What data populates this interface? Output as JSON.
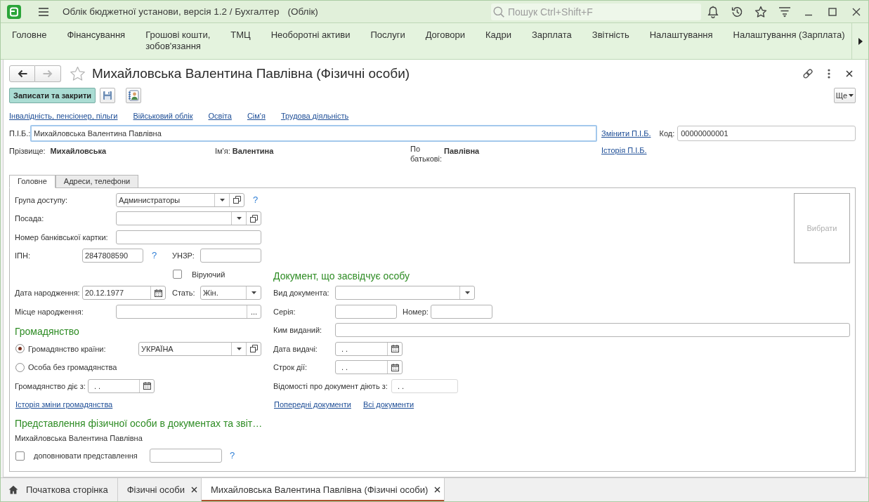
{
  "title_bar": {
    "title": "Облік бюджетної установи, версія 1.2 / Бухгалтер",
    "mode": "(Облік)",
    "search": {
      "placeholder": "Пошук Ctrl+Shift+F"
    }
  },
  "sections": [
    "Головне",
    "Фінансування",
    "Грошові кошти,\nзобов'язання",
    "ТМЦ",
    "Необоротні активи",
    "Послуги",
    "Договори",
    "Кадри",
    "Зарплата",
    "Звітність",
    "Налаштування",
    "Налаштування (Зарплата)"
  ],
  "form": {
    "navigation": [
      {
        "kind": "back",
        "disabled": false
      },
      {
        "kind": "forward",
        "disabled": true
      }
    ],
    "favorite": false,
    "title": "Михайловська Валентина Павлівна (Фізичні особи)",
    "save_close_button": "Записати та закрити",
    "more_button": "Ще",
    "links": [
      "Інвалідність, пенсіонер, пільги",
      "Військовий облік",
      "Освіта",
      "Сім'я",
      "Трудова діяльність"
    ],
    "full_name": {
      "label": "П.І.Б.:",
      "value": "Михайловська Валентина Павлівна",
      "focused": true
    },
    "change_name_link": "Змінити П.І.Б.",
    "code": {
      "label": "Код:",
      "value": "00000000001"
    },
    "name_parts": [
      {
        "label": "Прізвище:",
        "value": "Михайловська"
      },
      {
        "label": "Ім'я:",
        "value": "Валентина"
      },
      {
        "label": "По батькові:",
        "value": "Павлівна"
      }
    ],
    "name_history_link": "Історія П.І.Б.",
    "tabs": [
      {
        "label": "Головне",
        "selected": true
      },
      {
        "label": "Адреси, телефони",
        "selected": false
      }
    ],
    "main": {
      "access_group": {
        "label": "Група доступу:",
        "value": "Администраторы",
        "help": "?"
      },
      "position": {
        "label": "Посада:"
      },
      "bank_card": {
        "label": "Номер банківської картки:"
      },
      "tax_id": {
        "label": "ІПН:",
        "value": "2847808590",
        "help": "?"
      },
      "unzr": {
        "label": "УНЗР:"
      },
      "religious": {
        "label": "Віруючий",
        "checked": false
      },
      "birth_date": {
        "label": "Дата народження:",
        "value": "20.12.1977"
      },
      "sex": {
        "label": "Стать:",
        "value": "Жін."
      },
      "birth_place": {
        "label": "Місце народження:",
        "button": "..."
      },
      "citizenship": {
        "heading": "Громадянство",
        "options": [
          {
            "label": "Громадянство країни:",
            "selected": true
          },
          {
            "label": "Особа без громадянства",
            "selected": false
          }
        ],
        "country": "УКРАЇНА",
        "valid_from": {
          "label": "Громадянство діє з:",
          "value": ". ."
        },
        "history_link": "Історія зміни громадянства"
      },
      "representation": {
        "heading": "Представлення фізичної особи в документах та звіт…",
        "text": "Михайловська Валентина Павлівна",
        "supplement": {
          "label": "доповнювати представлення",
          "checked": false
        },
        "help": "?"
      },
      "photo": {
        "button": "Вибрати"
      },
      "identity_document": {
        "heading": "Документ, що засвідчує особу",
        "type": {
          "label": "Вид документа:"
        },
        "series": {
          "label": "Серія:"
        },
        "number": {
          "label": "Номер:"
        },
        "issued_by": {
          "label": "Ким виданий:"
        },
        "issue_date": {
          "label": "Дата видачі:",
          "value": ". ."
        },
        "expiry_date": {
          "label": "Строк дії:",
          "value": ". ."
        },
        "valid_from": {
          "label": "Відомості про документ діють з:",
          "value": ". .",
          "disabled": true
        },
        "links": [
          "Попередні документи",
          "Всі документи"
        ]
      }
    }
  },
  "open_windows": [
    {
      "kind": "home",
      "label": "Початкова сторінка",
      "selected": false
    },
    {
      "kind": "window",
      "label": "Фізичні особи",
      "selected": false
    },
    {
      "kind": "window",
      "label": "Михайловська Валентина Павлівна (Фізичні особи)",
      "selected": true
    }
  ]
}
